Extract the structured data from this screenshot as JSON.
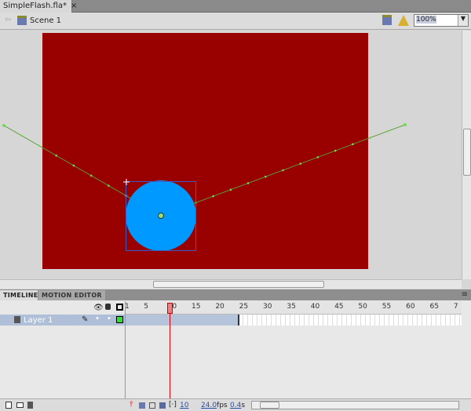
{
  "document_tab": {
    "title": "SimpleFlash.fla*",
    "close": "×"
  },
  "edit_bar": {
    "scene": "Scene 1",
    "zoom": "100%"
  },
  "stage": {
    "background": "#990000",
    "symbol_color": "#0099ff"
  },
  "timeline": {
    "tabs": [
      {
        "label": "TIMELINE"
      },
      {
        "label": "MOTION EDITOR"
      }
    ],
    "frame_labels": [
      "1",
      "5",
      "10",
      "15",
      "20",
      "25",
      "30",
      "35",
      "40",
      "45",
      "50",
      "55",
      "60",
      "65",
      "7"
    ],
    "current_frame": 10,
    "layers": [
      {
        "name": "Layer 1"
      }
    ],
    "status": {
      "frame": "10",
      "fps": "24.0",
      "fps_unit": "fps",
      "time": "0.4",
      "time_unit": "s"
    }
  }
}
